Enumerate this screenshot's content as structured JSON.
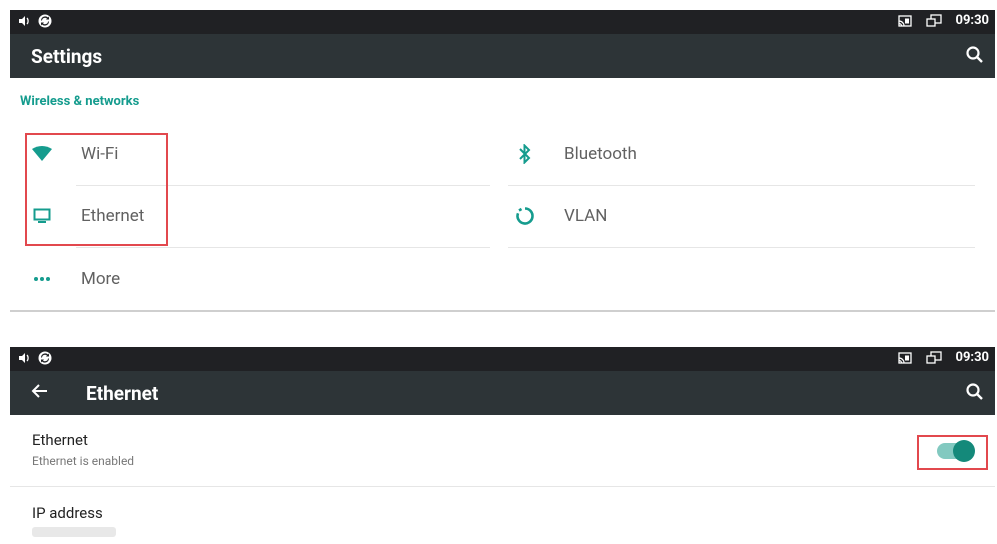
{
  "top_screen": {
    "status_time": "09:30",
    "app_title": "Settings",
    "section_title": "Wireless & networks",
    "items": [
      {
        "label": "Wi-Fi",
        "icon": "wifi-icon"
      },
      {
        "label": "Ethernet",
        "icon": "monitor-icon"
      },
      {
        "label": "More",
        "icon": "more-dots-icon"
      },
      {
        "label": "Bluetooth",
        "icon": "bluetooth-icon"
      },
      {
        "label": "VLAN",
        "icon": "vlan-icon"
      }
    ]
  },
  "bottom_screen": {
    "status_time": "09:30",
    "app_title": "Ethernet",
    "ethernet": {
      "title": "Ethernet",
      "subtitle": "Ethernet is enabled",
      "enabled": true
    },
    "ip_address": {
      "title": "IP address"
    }
  },
  "colors": {
    "status_bar": "#202124",
    "app_bar": "#2d3437",
    "accent": "#159c8e",
    "highlight": "#e2484e"
  }
}
